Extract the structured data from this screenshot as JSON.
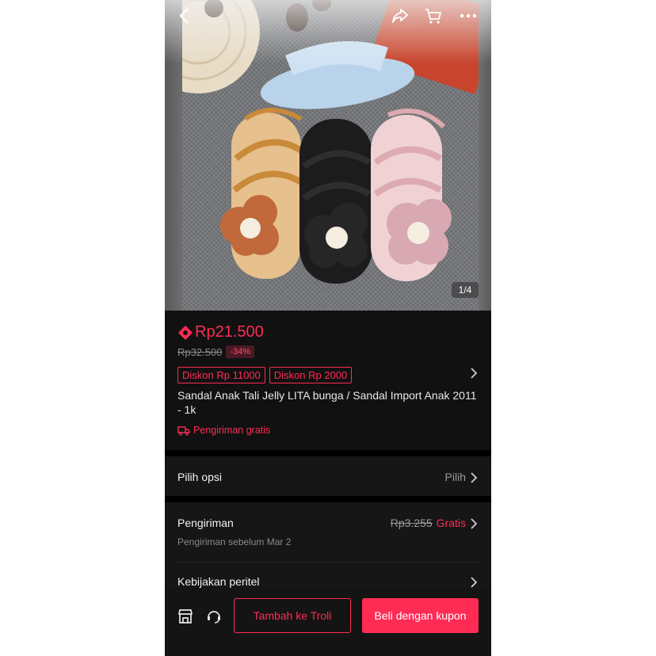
{
  "image": {
    "counter": "1/4"
  },
  "header_icons": [
    "back-icon",
    "share-icon",
    "cart-icon",
    "more-icon"
  ],
  "price": {
    "current": "Rp21.500",
    "original": "Rp32.500",
    "discount": "-34%"
  },
  "vouchers": [
    "Diskon Rp 11000",
    "Diskon Rp 2000"
  ],
  "product": {
    "title": "Sandal Anak Tali Jelly LITA bunga / Sandal Import Anak 2011 - 1k"
  },
  "shipping_badge": "Pengiriman gratis",
  "options": {
    "label": "Pilih opsi",
    "value": "Pilih"
  },
  "shipping": {
    "label": "Pengiriman",
    "old_price": "Rp3.255",
    "price": "Gratis",
    "subtitle": "Pengiriman sebelum Mar 2"
  },
  "policy": {
    "label": "Kebijakan peritel"
  },
  "actions": {
    "add_to_cart": "Tambah ke Troli",
    "buy": "Beli dengan kupon"
  },
  "colors": {
    "accent": "#fe2c55",
    "background": "#111111"
  }
}
